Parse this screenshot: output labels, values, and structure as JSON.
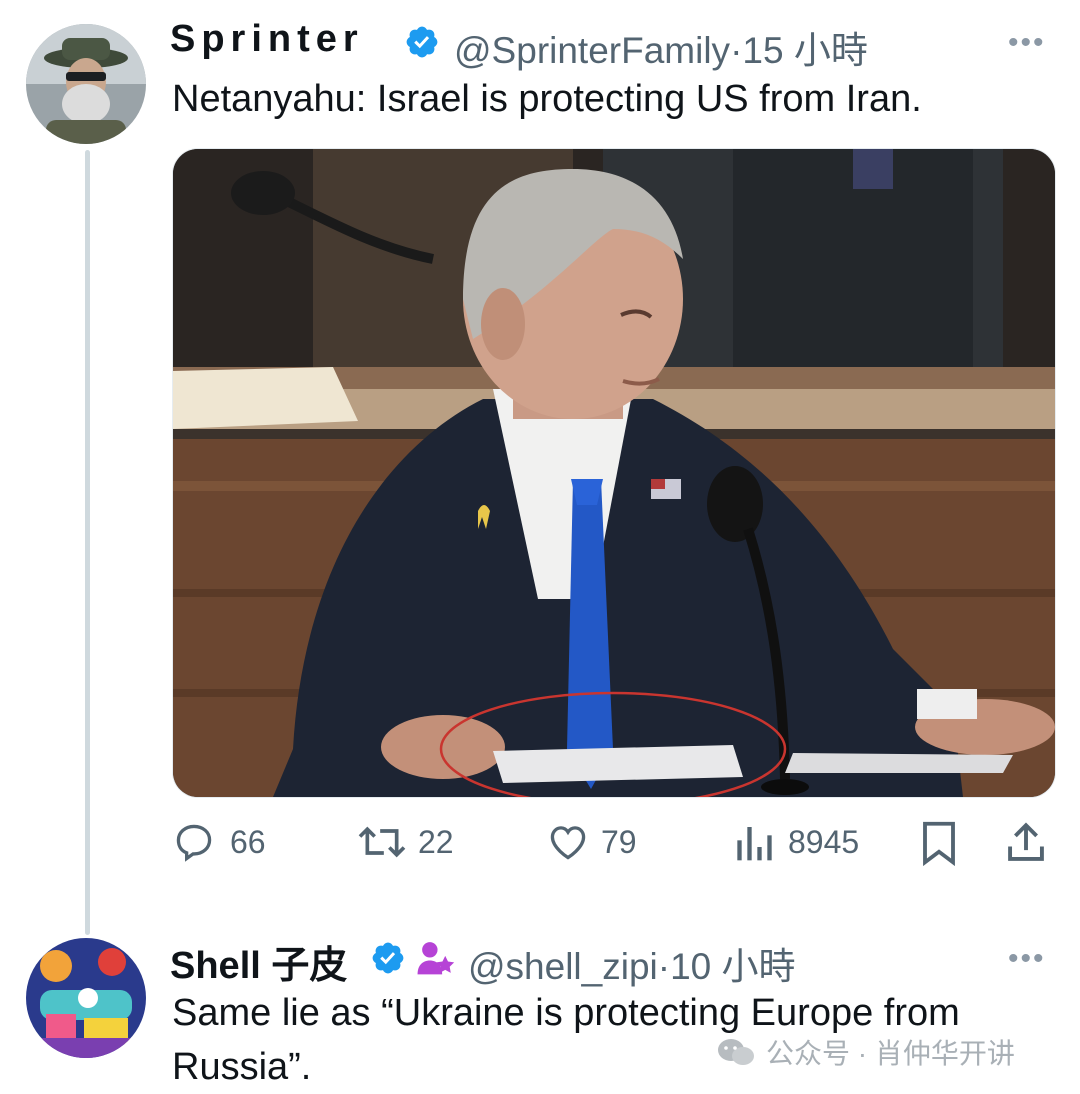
{
  "tweet1": {
    "name": "Sprinter",
    "handle": "@SprinterFamily",
    "time": "·15 小時",
    "text": "Netanyahu: Israel is protecting US from Iran.",
    "more": "•••",
    "stats": {
      "replies": "66",
      "retweets": "22",
      "likes": "79",
      "views": "8945"
    }
  },
  "tweet2": {
    "name": "Shell 子皮",
    "handle": "@shell_zipi",
    "time": "·10 小時",
    "text": "Same lie as “Ukraine is protecting Europe from Russia”.",
    "more": "•••"
  },
  "watermark": {
    "text": "公众号 · 肖仲华开讲"
  },
  "colors": {
    "verified": "#1d9bf0",
    "subscription_badge": "#b643d6",
    "icon_gray": "#536471",
    "tie_blue": "#2358c6"
  }
}
